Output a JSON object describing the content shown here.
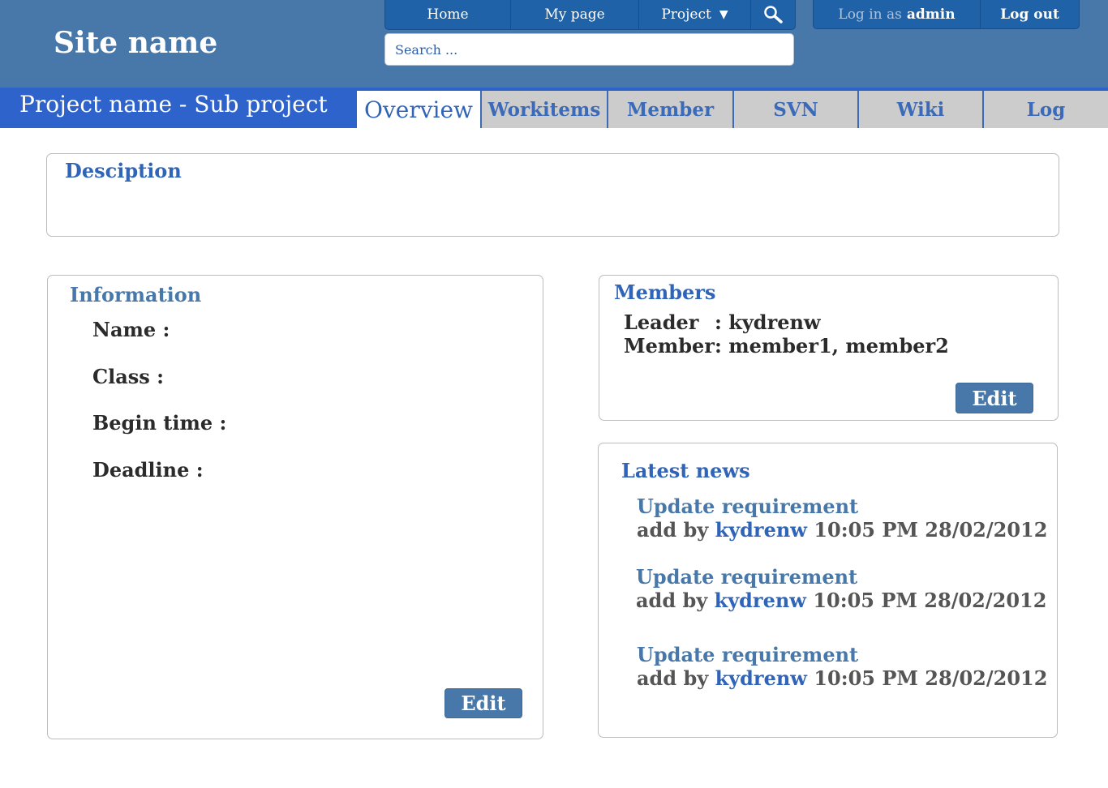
{
  "header": {
    "site_name": "Site name",
    "nav": [
      {
        "label": "Home"
      },
      {
        "label": "My page"
      },
      {
        "label": "Project"
      }
    ],
    "search_placeholder": "Search ...",
    "auth": {
      "login_prefix": "Log in as",
      "user": "admin",
      "logout_label": "Log out"
    }
  },
  "project": {
    "title": "Project name - Sub project",
    "tabs": [
      {
        "label": "Overview",
        "active": true
      },
      {
        "label": "Workitems"
      },
      {
        "label": "Member"
      },
      {
        "label": "SVN"
      },
      {
        "label": "Wiki"
      },
      {
        "label": "Log"
      }
    ]
  },
  "description": {
    "title": "Desciption"
  },
  "information": {
    "title": "Information",
    "fields": [
      {
        "label": "Name :"
      },
      {
        "label": "Class :"
      },
      {
        "label": "Begin time :"
      },
      {
        "label": "Deadline :"
      }
    ],
    "edit_label": "Edit"
  },
  "members": {
    "title": "Members",
    "leader_label": "Leader",
    "leader_value": ": kydrenw",
    "member_label": "Member",
    "member_value": ": member1, member2",
    "edit_label": "Edit"
  },
  "news": {
    "title": "Latest news",
    "items": [
      {
        "title": "Update requirement",
        "prefix": "add by",
        "author": "kydrenw",
        "time": "10:05 PM 28/02/2012"
      },
      {
        "title": "Update requirement",
        "prefix": "add by",
        "author": "kydrenw",
        "time": "10:05 PM 28/02/2012"
      },
      {
        "title": "Update requirement",
        "prefix": "add by",
        "author": "kydrenw",
        "time": "10:05 PM 28/02/2012"
      }
    ]
  },
  "colors": {
    "header_bg": "#4778a9",
    "nav_bg": "#1f62a8",
    "project_bar": "#2e63cc",
    "accent": "#2f64b8",
    "tab_bg": "#cccccc",
    "button_bg": "#4778a9"
  },
  "icons": {
    "search": "search-icon",
    "dropdown": "caret-down-icon"
  }
}
